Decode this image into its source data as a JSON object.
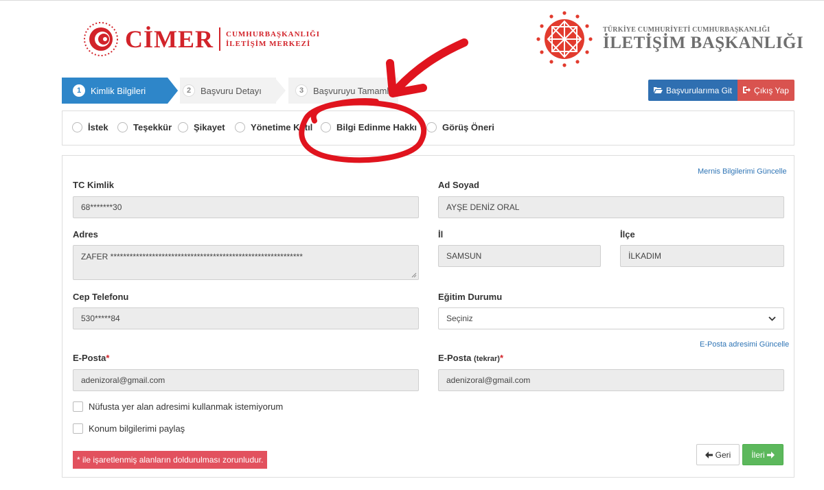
{
  "header": {
    "cimer_wordmark": "CİMER",
    "cimer_sub_line1": "CUMHURBAŞKANLIĞI",
    "cimer_sub_line2": "İLETİŞİM MERKEZİ",
    "iletisim_small": "TÜRKİYE CUMHURİYETİ CUMHURBAŞKANLIĞI",
    "iletisim_big": "İLETİŞİM BAŞKANLIĞI"
  },
  "steps": [
    {
      "num": "1",
      "label": "Kimlik Bilgileri",
      "active": true
    },
    {
      "num": "2",
      "label": "Başvuru Detayı",
      "active": false
    },
    {
      "num": "3",
      "label": "Başvuruyu Tamamla",
      "active": false
    }
  ],
  "actions": {
    "basvurularim": "Başvurularıma Git",
    "cikis": "Çıkış Yap"
  },
  "types": [
    "İstek",
    "Teşekkür",
    "Şikayet",
    "Yönetime Katıl",
    "Bilgi Edinme Hakkı",
    "Görüş Öneri"
  ],
  "form": {
    "mernis_link": "Mernis Bilgilerimi Güncelle",
    "tc_label": "TC Kimlik",
    "tc_value": "68*******30",
    "adsoyad_label": "Ad Soyad",
    "adsoyad_value": "AYŞE DENİZ ORAL",
    "adres_label": "Adres",
    "adres_value": "ZAFER ************************************************************",
    "il_label": "İl",
    "il_value": "SAMSUN",
    "ilce_label": "İlçe",
    "ilce_value": "İLKADIM",
    "cep_label": "Cep Telefonu",
    "cep_value": "530*****84",
    "egitim_label": "Eğitim Durumu",
    "egitim_value": "Seçiniz",
    "eposta_link": "E-Posta adresimi Güncelle",
    "eposta_label": "E-Posta",
    "eposta_value": "adenizoral@gmail.com",
    "eposta2_label": "E-Posta",
    "eposta2_small": "(tekrar)",
    "eposta2_value": "adenizoral@gmail.com",
    "req_mark": "*",
    "chk_nufus": "Nüfusta yer alan adresimi kullanmak istemiyorum",
    "chk_konum": "Konum bilgilerimi paylaş",
    "required_note": "* ile işaretlenmiş alanların doldurulması zorunludur.",
    "geri": "Geri",
    "ileri": "İleri"
  },
  "colors": {
    "brand_red": "#d2232a",
    "step_active": "#2e86c9",
    "button_blue": "#2f6fb1",
    "button_red": "#d9534f",
    "button_green": "#5cb85c",
    "annotation_red": "#e0141e"
  }
}
